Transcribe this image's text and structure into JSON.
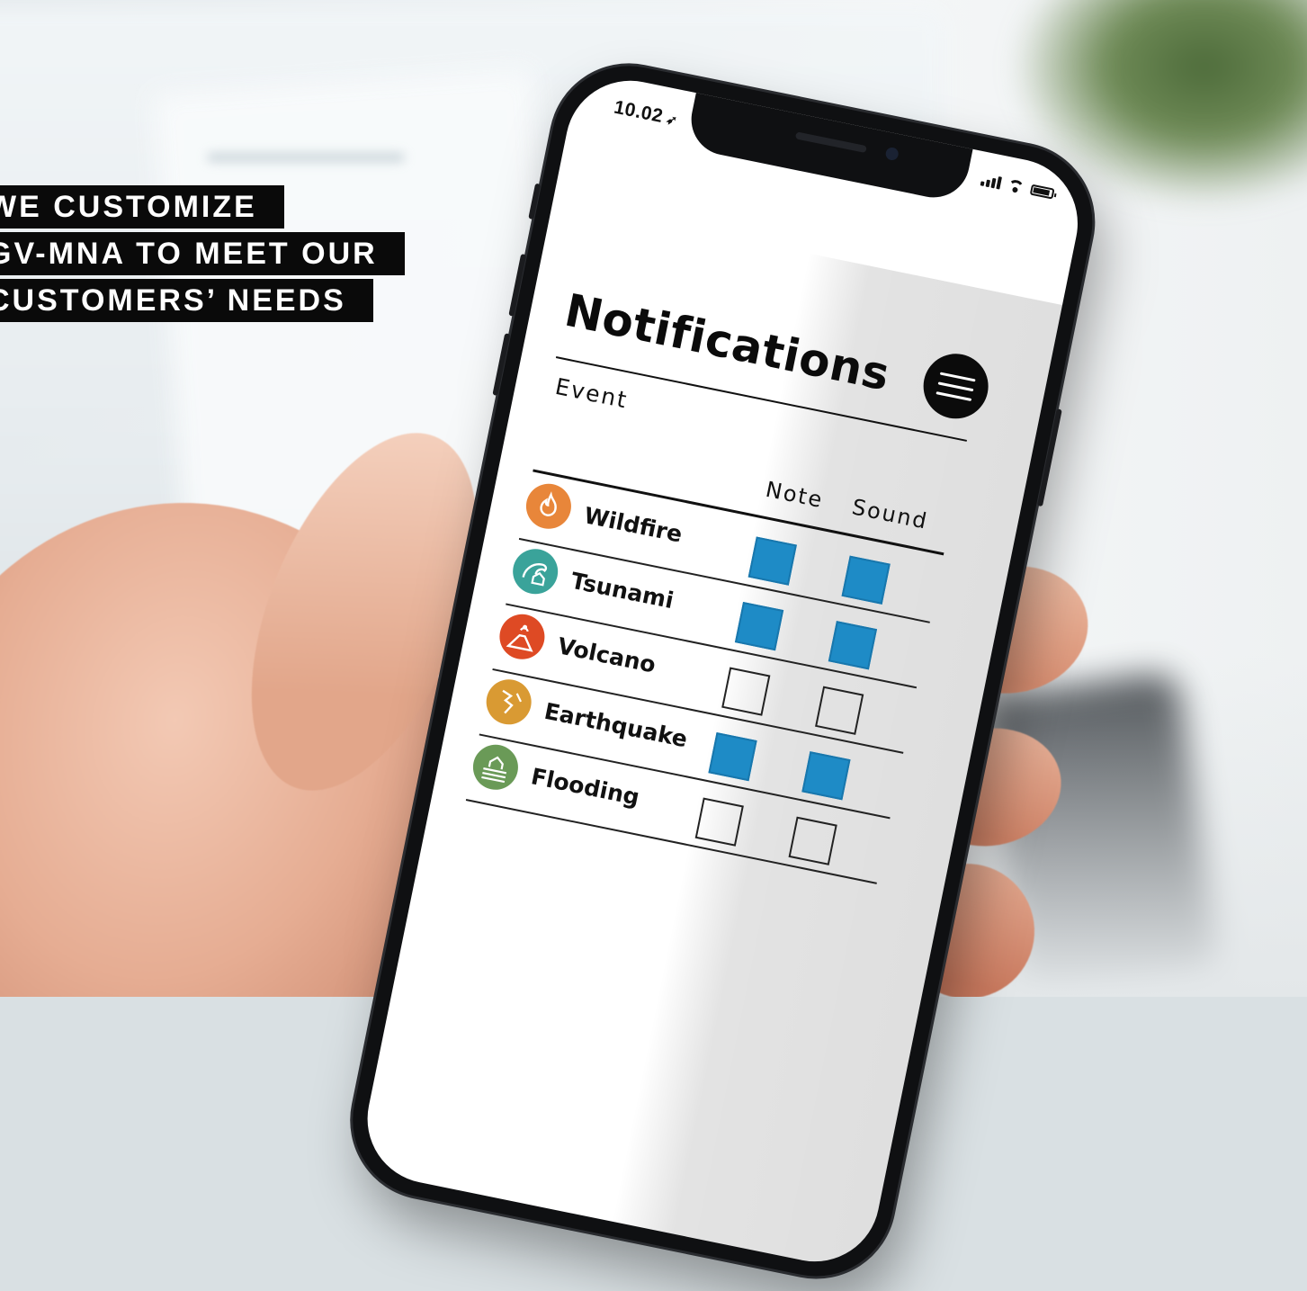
{
  "tagline": {
    "lines": [
      "WE CUSTOMIZE",
      "GV-MNA TO MEET OUR",
      "CUSTOMERS’ NEEDS"
    ]
  },
  "status_bar": {
    "time": "10.02",
    "location_icon": "location-arrow-icon"
  },
  "screen": {
    "title": "Notifications",
    "menu_icon": "hamburger-menu-icon",
    "columns": {
      "event": "Event",
      "note": "Note",
      "sound": "Sound"
    },
    "events": [
      {
        "name": "Wildfire",
        "icon": "flame-icon",
        "color": "#e8863a",
        "note": true,
        "sound": true
      },
      {
        "name": "Tsunami",
        "icon": "wave-house-icon",
        "color": "#3aa39a",
        "note": true,
        "sound": true
      },
      {
        "name": "Volcano",
        "icon": "volcano-icon",
        "color": "#de4a24",
        "note": false,
        "sound": false
      },
      {
        "name": "Earthquake",
        "icon": "quake-crack-icon",
        "color": "#d99a33",
        "note": true,
        "sound": true
      },
      {
        "name": "Flooding",
        "icon": "flood-house-icon",
        "color": "#6a9a57",
        "note": false,
        "sound": false
      }
    ],
    "checkbox_on_color": "#1e8bc6"
  }
}
